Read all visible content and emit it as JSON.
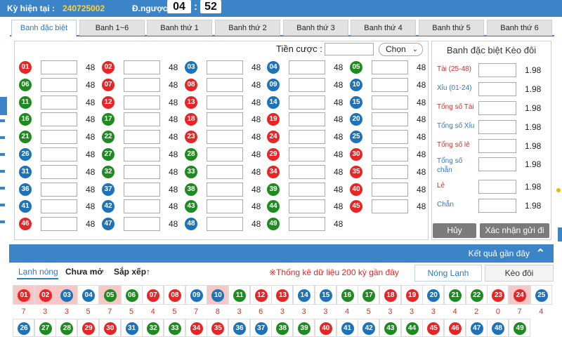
{
  "header": {
    "period_label": "Kỳ hiện tại :",
    "period_value": "240725002",
    "countdown_label": "Đ.ngược :",
    "countdown_min": "04",
    "countdown_sec": "52"
  },
  "tabs": [
    "Banh đặc biệt",
    "Banh 1~6",
    "Banh thứ 1",
    "Banh thứ 2",
    "Banh thứ 3",
    "Banh thứ 4",
    "Banh thứ 5",
    "Banh thứ 6"
  ],
  "bet": {
    "stake_label": "Tiền cược :",
    "choose_label": "Chọn",
    "odds": "48",
    "numbers": [
      {
        "n": "01",
        "c": "red"
      },
      {
        "n": "02",
        "c": "red"
      },
      {
        "n": "03",
        "c": "blue"
      },
      {
        "n": "04",
        "c": "blue"
      },
      {
        "n": "05",
        "c": "green"
      },
      {
        "n": "06",
        "c": "green"
      },
      {
        "n": "07",
        "c": "red"
      },
      {
        "n": "08",
        "c": "red"
      },
      {
        "n": "09",
        "c": "blue"
      },
      {
        "n": "10",
        "c": "blue"
      },
      {
        "n": "11",
        "c": "green"
      },
      {
        "n": "12",
        "c": "red"
      },
      {
        "n": "13",
        "c": "red"
      },
      {
        "n": "14",
        "c": "blue"
      },
      {
        "n": "15",
        "c": "blue"
      },
      {
        "n": "16",
        "c": "green"
      },
      {
        "n": "17",
        "c": "green"
      },
      {
        "n": "18",
        "c": "red"
      },
      {
        "n": "19",
        "c": "red"
      },
      {
        "n": "20",
        "c": "blue"
      },
      {
        "n": "21",
        "c": "green"
      },
      {
        "n": "22",
        "c": "green"
      },
      {
        "n": "23",
        "c": "red"
      },
      {
        "n": "24",
        "c": "red"
      },
      {
        "n": "25",
        "c": "blue"
      },
      {
        "n": "26",
        "c": "blue"
      },
      {
        "n": "27",
        "c": "green"
      },
      {
        "n": "28",
        "c": "green"
      },
      {
        "n": "29",
        "c": "red"
      },
      {
        "n": "30",
        "c": "red"
      },
      {
        "n": "31",
        "c": "blue"
      },
      {
        "n": "32",
        "c": "green"
      },
      {
        "n": "33",
        "c": "green"
      },
      {
        "n": "34",
        "c": "red"
      },
      {
        "n": "35",
        "c": "red"
      },
      {
        "n": "36",
        "c": "blue"
      },
      {
        "n": "37",
        "c": "blue"
      },
      {
        "n": "38",
        "c": "green"
      },
      {
        "n": "39",
        "c": "green"
      },
      {
        "n": "40",
        "c": "red"
      },
      {
        "n": "41",
        "c": "blue"
      },
      {
        "n": "42",
        "c": "blue"
      },
      {
        "n": "43",
        "c": "green"
      },
      {
        "n": "44",
        "c": "green"
      },
      {
        "n": "45",
        "c": "red"
      },
      {
        "n": "46",
        "c": "red"
      },
      {
        "n": "47",
        "c": "blue"
      },
      {
        "n": "48",
        "c": "blue"
      },
      {
        "n": "49",
        "c": "green"
      }
    ]
  },
  "side": {
    "title": "Banh đặc biệt Kèo đôi",
    "rows": [
      {
        "label": "Tài (25-48)",
        "color": "#c0392b",
        "odd": "1.98"
      },
      {
        "label": "Xỉu (01-24)",
        "color": "#2f78c2",
        "odd": "1.98"
      },
      {
        "label": "Tổng số Tài",
        "color": "#c0392b",
        "odd": "1.98"
      },
      {
        "label": "Tổng số Xỉu",
        "color": "#2f78c2",
        "odd": "1.98"
      },
      {
        "label": "Tổng số lẻ",
        "color": "#c0392b",
        "odd": "1.98"
      },
      {
        "label": "Tổng số chẵn",
        "color": "#2f78c2",
        "odd": "1.98"
      },
      {
        "label": "Lẻ",
        "color": "#c0392b",
        "odd": "1.98"
      },
      {
        "label": "Chẵn",
        "color": "#2f78c2",
        "odd": "1.98"
      }
    ],
    "cancel_label": "Hủy",
    "confirm_label": "Xác nhận gửi đi"
  },
  "results": {
    "header": "Kết quả gần đây",
    "tabs": [
      "Lạnh nóng",
      "Chưa mở",
      "Sắp xếp↑"
    ],
    "stat_note": "※Thống kê dữ liệu 200 kỳ gần đây",
    "right_tabs": [
      "Nóng Lạnh",
      "Kèo đôi"
    ],
    "row1": [
      {
        "n": "01",
        "c": "red",
        "cnt": "7",
        "hl": true
      },
      {
        "n": "02",
        "c": "red",
        "cnt": "3",
        "hl": true
      },
      {
        "n": "03",
        "c": "blue",
        "cnt": "3",
        "hl": true
      },
      {
        "n": "04",
        "c": "blue",
        "cnt": "5",
        "hl": false
      },
      {
        "n": "05",
        "c": "green",
        "cnt": "7",
        "hl": true
      },
      {
        "n": "06",
        "c": "green",
        "cnt": "5",
        "hl": false
      },
      {
        "n": "07",
        "c": "red",
        "cnt": "4",
        "hl": false
      },
      {
        "n": "08",
        "c": "red",
        "cnt": "5",
        "hl": false
      },
      {
        "n": "09",
        "c": "blue",
        "cnt": "7",
        "hl": false
      },
      {
        "n": "10",
        "c": "blue",
        "cnt": "8",
        "hl": true
      },
      {
        "n": "11",
        "c": "green",
        "cnt": "3",
        "hl": false
      },
      {
        "n": "12",
        "c": "red",
        "cnt": "6",
        "hl": false
      },
      {
        "n": "13",
        "c": "red",
        "cnt": "3",
        "hl": false
      },
      {
        "n": "14",
        "c": "blue",
        "cnt": "3",
        "hl": false
      },
      {
        "n": "15",
        "c": "blue",
        "cnt": "3",
        "hl": false
      },
      {
        "n": "16",
        "c": "green",
        "cnt": "4",
        "hl": false
      },
      {
        "n": "17",
        "c": "green",
        "cnt": "5",
        "hl": false
      },
      {
        "n": "18",
        "c": "red",
        "cnt": "3",
        "hl": false
      },
      {
        "n": "19",
        "c": "red",
        "cnt": "3",
        "hl": false
      },
      {
        "n": "20",
        "c": "blue",
        "cnt": "3",
        "hl": false
      },
      {
        "n": "21",
        "c": "green",
        "cnt": "4",
        "hl": false
      },
      {
        "n": "22",
        "c": "green",
        "cnt": "2",
        "hl": false
      },
      {
        "n": "23",
        "c": "red",
        "cnt": "0",
        "hl": false
      },
      {
        "n": "24",
        "c": "red",
        "cnt": "7",
        "hl": true
      },
      {
        "n": "25",
        "c": "blue",
        "cnt": "4",
        "hl": false
      }
    ],
    "row2": [
      {
        "n": "26",
        "c": "blue"
      },
      {
        "n": "27",
        "c": "green"
      },
      {
        "n": "28",
        "c": "green"
      },
      {
        "n": "29",
        "c": "red"
      },
      {
        "n": "30",
        "c": "red"
      },
      {
        "n": "31",
        "c": "blue"
      },
      {
        "n": "32",
        "c": "green"
      },
      {
        "n": "33",
        "c": "green"
      },
      {
        "n": "34",
        "c": "red"
      },
      {
        "n": "35",
        "c": "red"
      },
      {
        "n": "36",
        "c": "blue"
      },
      {
        "n": "37",
        "c": "blue"
      },
      {
        "n": "38",
        "c": "green"
      },
      {
        "n": "39",
        "c": "green"
      },
      {
        "n": "40",
        "c": "red"
      },
      {
        "n": "41",
        "c": "blue"
      },
      {
        "n": "42",
        "c": "blue"
      },
      {
        "n": "43",
        "c": "green"
      },
      {
        "n": "44",
        "c": "green"
      },
      {
        "n": "45",
        "c": "red"
      },
      {
        "n": "46",
        "c": "red"
      },
      {
        "n": "47",
        "c": "blue"
      },
      {
        "n": "48",
        "c": "blue"
      },
      {
        "n": "49",
        "c": "green"
      }
    ]
  },
  "colors": {
    "accent": "#3c84c8",
    "red": "#e62626",
    "blue": "#1e73b8",
    "green": "#1f8a1f"
  }
}
